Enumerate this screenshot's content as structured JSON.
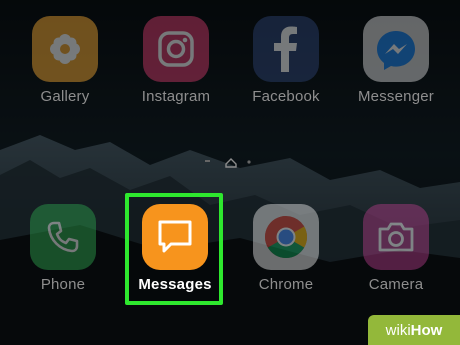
{
  "top_row": [
    {
      "label": "Gallery",
      "icon": "gallery-flower-icon",
      "color": "#f2a733"
    },
    {
      "label": "Instagram",
      "icon": "instagram-camera-icon",
      "color": "#d03a6a"
    },
    {
      "label": "Facebook",
      "icon": "facebook-f-icon",
      "color": "#3b5998"
    },
    {
      "label": "Messenger",
      "icon": "messenger-bolt-icon",
      "color": "#1f87f0"
    }
  ],
  "bottom_row": [
    {
      "label": "Phone",
      "icon": "phone-handset-icon",
      "color": "#2ea44f"
    },
    {
      "label": "Messages",
      "icon": "chat-bubble-icon",
      "color": "#f7941d"
    },
    {
      "label": "Chrome",
      "icon": "chrome-logo-icon",
      "color": "#e0e0e0"
    },
    {
      "label": "Camera",
      "icon": "camera-icon",
      "color": "#b23c88"
    }
  ],
  "highlight_color": "#2ee82e",
  "watermark": {
    "part1": "wiki",
    "part2": "How",
    "color": "#93b83a"
  }
}
